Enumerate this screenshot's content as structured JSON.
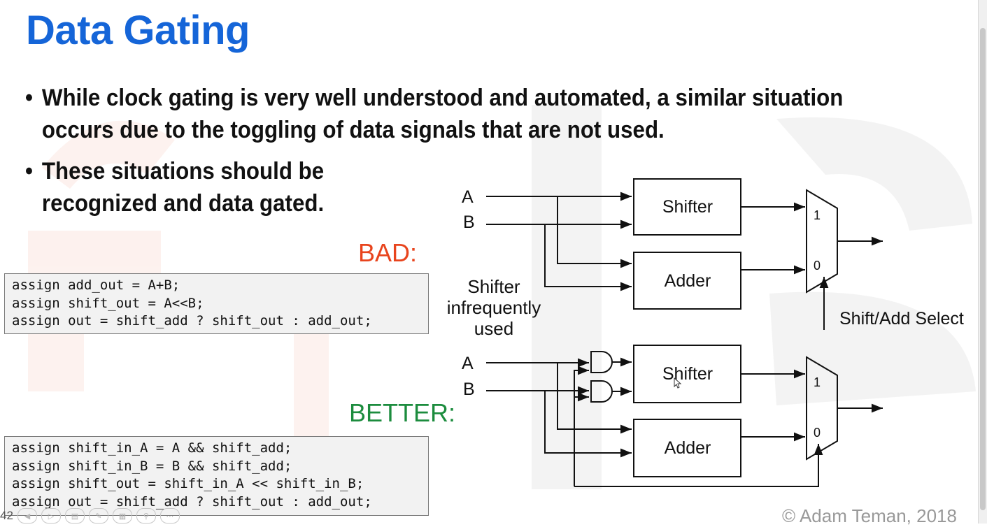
{
  "title": "Data Gating",
  "bullets": [
    {
      "line1": "While clock gating is very well understood and automated, a similar situation",
      "line2": "occurs due to the toggling of data signals that are not used."
    },
    {
      "line1": "These situations should be",
      "line2": "recognized and data gated."
    }
  ],
  "bad": {
    "label": "BAD:",
    "code": [
      "assign add_out = A+B;",
      "assign shift_out = A<<B;",
      "assign out = shift_add ? shift_out : add_out;"
    ]
  },
  "note": [
    "Shifter",
    "infrequently",
    "used"
  ],
  "better": {
    "label": "BETTER:",
    "code": [
      "assign shift_in_A = A && shift_add;",
      "assign shift_in_B = B && shift_add;",
      "assign shift_out = shift_in_A << shift_in_B;",
      "assign out = shift_add ? shift_out : add_out;"
    ]
  },
  "diagram": {
    "input_a": "A",
    "input_b": "B",
    "shifter": "Shifter",
    "adder": "Adder",
    "mux_in1": "1",
    "mux_in0": "0",
    "select_label": "Shift/Add Select"
  },
  "copyright": "© Adam Teman, 2018",
  "slide_number": "42",
  "colors": {
    "title": "#1565d8",
    "bad": "#e8441d",
    "better": "#1c8c3e"
  },
  "controls": [
    "previous-icon",
    "play-icon",
    "notes-icon",
    "pen-icon",
    "grid-icon",
    "zoom-icon",
    "more-icon"
  ]
}
